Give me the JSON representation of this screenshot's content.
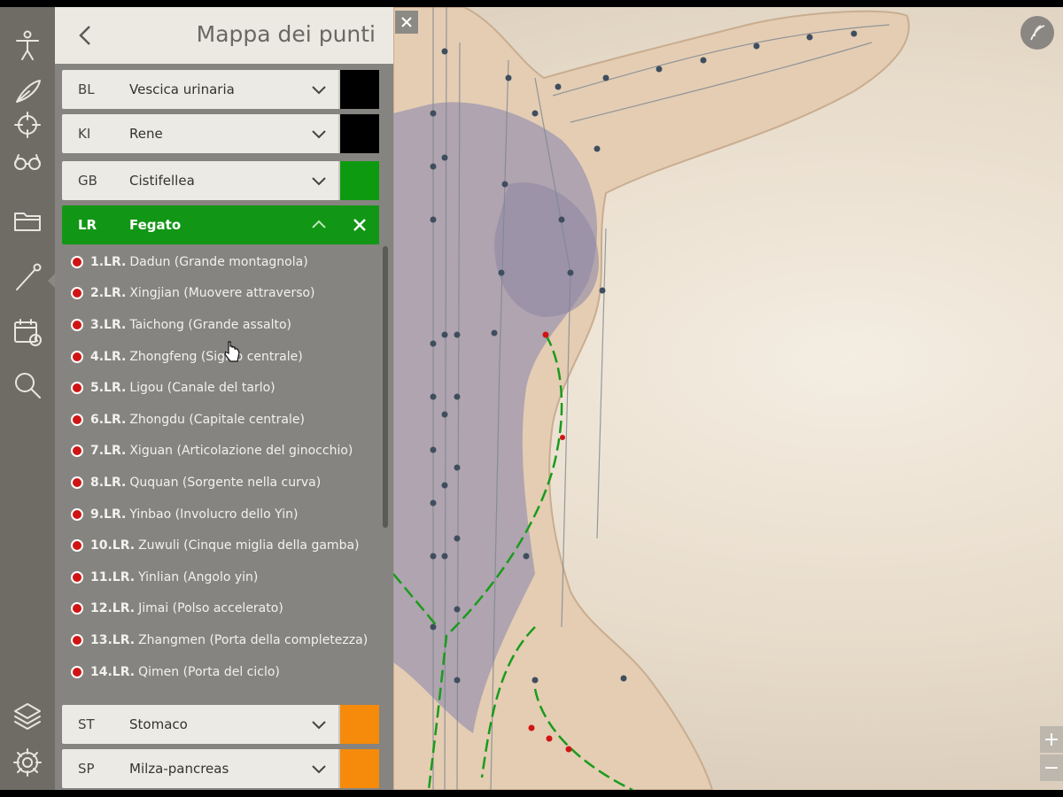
{
  "panel": {
    "title": "Mappa dei punti",
    "meridians_top": [
      {
        "code": "BL",
        "name": "Vescica urinaria",
        "color": "#000000"
      },
      {
        "code": "KI",
        "name": "Rene",
        "color": "#000000"
      },
      {
        "code": "GB",
        "name": "Cistifellea",
        "color": "#0e9a10"
      }
    ],
    "open_meridian": {
      "code": "LR",
      "name": "Fegato",
      "color": "#129615"
    },
    "points": [
      {
        "id": "1.LR.",
        "label": "Dadun (Grande montagnola)"
      },
      {
        "id": "2.LR.",
        "label": "Xingjian (Muovere attraverso)"
      },
      {
        "id": "3.LR.",
        "label": "Taichong (Grande assalto)"
      },
      {
        "id": "4.LR.",
        "label": "Zhongfeng (Sigillo centrale)"
      },
      {
        "id": "5.LR.",
        "label": "Ligou (Canale del tarlo)"
      },
      {
        "id": "6.LR.",
        "label": "Zhongdu (Capitale centrale)"
      },
      {
        "id": "7.LR.",
        "label": "Xiguan (Articolazione del ginocchio)"
      },
      {
        "id": "8.LR.",
        "label": "Ququan (Sorgente nella curva)"
      },
      {
        "id": "9.LR.",
        "label": "Yinbao (Involucro dello Yin)"
      },
      {
        "id": "10.LR.",
        "label": "Zuwuli (Cinque miglia della gamba)"
      },
      {
        "id": "11.LR.",
        "label": "Yinlian (Angolo yin)"
      },
      {
        "id": "12.LR.",
        "label": "Jimai (Polso accelerato)"
      },
      {
        "id": "13.LR.",
        "label": "Zhangmen (Porta della completezza)"
      },
      {
        "id": "14.LR.",
        "label": "Qimen (Porta del ciclo)"
      }
    ],
    "meridians_bottom": [
      {
        "code": "ST",
        "name": "Stomaco",
        "color": "#f58a0b"
      },
      {
        "code": "SP",
        "name": "Milza-pancreas",
        "color": "#f58a0b"
      }
    ]
  },
  "toolbar": {
    "items": [
      "body-icon",
      "feather-icon",
      "target-icon",
      "glasses-icon",
      "folder-icon",
      "needle-icon",
      "calendar-icon",
      "search-icon",
      "layers-icon",
      "gear-icon"
    ]
  },
  "zoom": {
    "in": "+",
    "out": "−"
  }
}
